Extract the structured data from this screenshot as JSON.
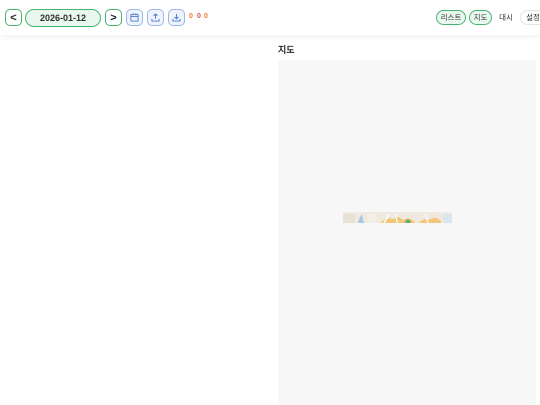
{
  "toolbar": {
    "prev_label": "<",
    "next_label": ">",
    "date": "2026-01-12",
    "icons": [
      "calendar-icon",
      "upload-icon",
      "download-icon"
    ],
    "counts": [
      {
        "value": "0",
        "color": "#f07b22"
      },
      {
        "value": "0",
        "color": "#e84b3c"
      },
      {
        "value": "0",
        "color": "#f07b22"
      }
    ]
  },
  "tabs": [
    {
      "label": "리스트",
      "state": "active"
    },
    {
      "label": "지도",
      "state": "active"
    },
    {
      "label": "대시",
      "state": "flat"
    },
    {
      "label": "설정",
      "state": "plain"
    }
  ],
  "map": {
    "title": "지도"
  },
  "colors": {
    "accent": "#46b46e",
    "accent_bg": "#e9f8ee",
    "icon_border": "#9cb8e6"
  }
}
